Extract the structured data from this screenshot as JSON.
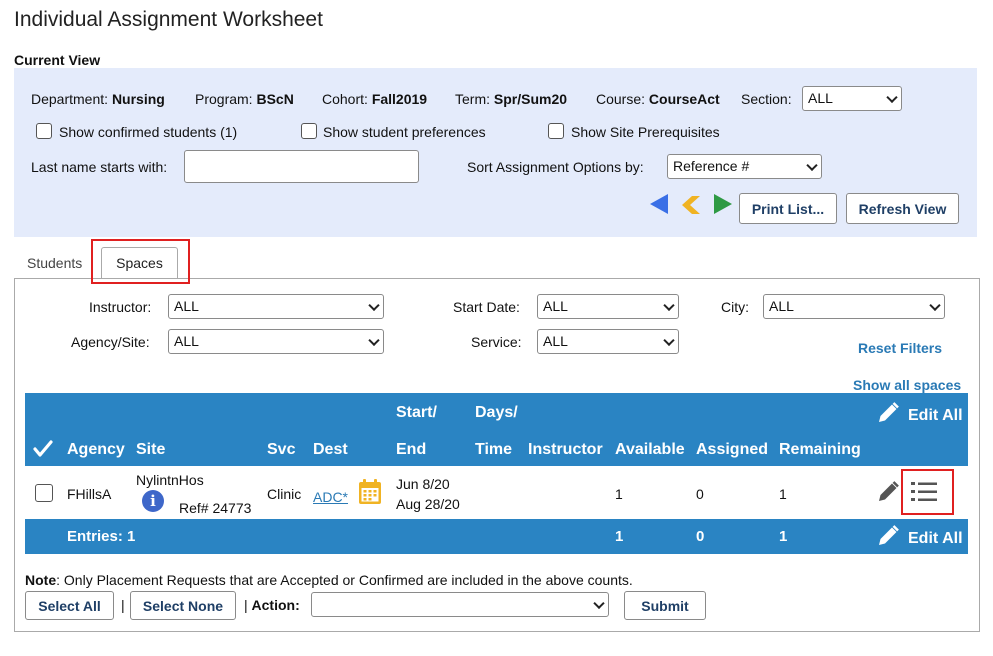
{
  "page": {
    "title": "Individual Assignment Worksheet",
    "current_view_label": "Current View"
  },
  "view": {
    "department_label": "Department:",
    "department_value": "Nursing",
    "program_label": "Program:",
    "program_value": "BScN",
    "cohort_label": "Cohort:",
    "cohort_value": "Fall2019",
    "term_label": "Term:",
    "term_value": "Spr/Sum20",
    "course_label": "Course:",
    "course_value": "CourseAct",
    "section_label": "Section:",
    "section_value": "ALL",
    "show_confirmed_label": "Show confirmed students (1)",
    "show_preferences_label": "Show student preferences",
    "show_prereq_label": "Show Site Prerequisites",
    "last_name_label": "Last name starts with:",
    "last_name_value": "",
    "sort_label": "Sort Assignment Options by:",
    "sort_value": "Reference #",
    "print_label": "Print List...",
    "refresh_label": "Refresh View",
    "colors": {
      "first": "#3a6fe6",
      "prev": "#f0b323",
      "next": "#2e9a44"
    }
  },
  "tabs": {
    "students": "Students",
    "spaces": "Spaces"
  },
  "filters": {
    "instructor_label": "Instructor:",
    "instructor_value": "ALL",
    "start_date_label": "Start Date:",
    "start_date_value": "ALL",
    "city_label": "City:",
    "city_value": "ALL",
    "agency_label": "Agency/Site:",
    "agency_value": "ALL",
    "service_label": "Service:",
    "service_value": "ALL",
    "reset_label": "Reset Filters",
    "show_all_label": "Show all spaces"
  },
  "grid": {
    "headers": {
      "agency": "Agency",
      "site": "Site",
      "svc": "Svc",
      "dest": "Dest",
      "start": "Start/",
      "end": "End",
      "days": "Days/",
      "time": "Time",
      "instructor": "Instructor",
      "available": "Available",
      "assigned": "Assigned",
      "remaining": "Remaining",
      "edit_all": "Edit All"
    },
    "row": {
      "agency": "FHillsA",
      "site": "NylintnHos",
      "ref": "Ref# 24773",
      "svc": "Clinic",
      "dest": "ADC*",
      "start": "Jun 8/20",
      "end": "Aug 28/20",
      "available": "1",
      "assigned": "0",
      "remaining": "1"
    },
    "footer": {
      "entries": "Entries: 1",
      "available": "1",
      "assigned": "0",
      "remaining": "1",
      "edit_all": "Edit All"
    }
  },
  "bottom": {
    "note_bold": "Note",
    "note_text": ": Only Placement Requests that are Accepted or Confirmed are included in the above counts.",
    "select_all": "Select All",
    "separator": "|",
    "select_none": "Select None",
    "action_prefix": "|",
    "action_label": "Action:",
    "action_value": "",
    "submit": "Submit"
  }
}
